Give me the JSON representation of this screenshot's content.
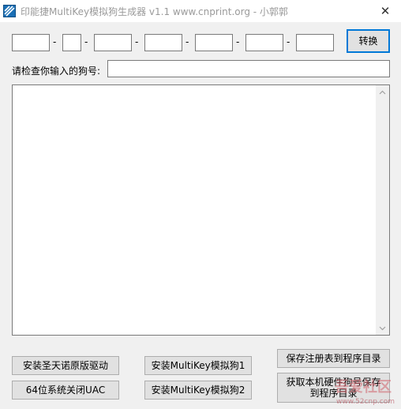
{
  "window": {
    "title": "印能捷MultiKey模拟狗生成器 v1.1 www.cnprint.org - 小郭郭",
    "close_glyph": "✕"
  },
  "serial": {
    "fields": [
      "",
      "",
      "",
      "",
      "",
      "",
      ""
    ],
    "separator": "-"
  },
  "convert_button": "转换",
  "check": {
    "label": "请检查你输入的狗号:",
    "value": ""
  },
  "output": {
    "text": ""
  },
  "buttons": {
    "install_sentinel": "安装圣天诺原版驱动",
    "install_multikey1": "安装MultiKey模拟狗1",
    "save_registry": "保存注册表到程序目录",
    "disable_uac": "64位系统关闭UAC",
    "install_multikey2": "安装MultiKey模拟狗2",
    "get_hardware": "获取本机硬件狗号保存到程序目录"
  },
  "watermark": {
    "brand": "吾爱社区",
    "url": "www.52cnp.com"
  },
  "icons": {
    "app": "app-stripes-icon",
    "close": "close-icon"
  },
  "colors": {
    "accent": "#0078d7",
    "title_text": "#9a9a9a"
  }
}
